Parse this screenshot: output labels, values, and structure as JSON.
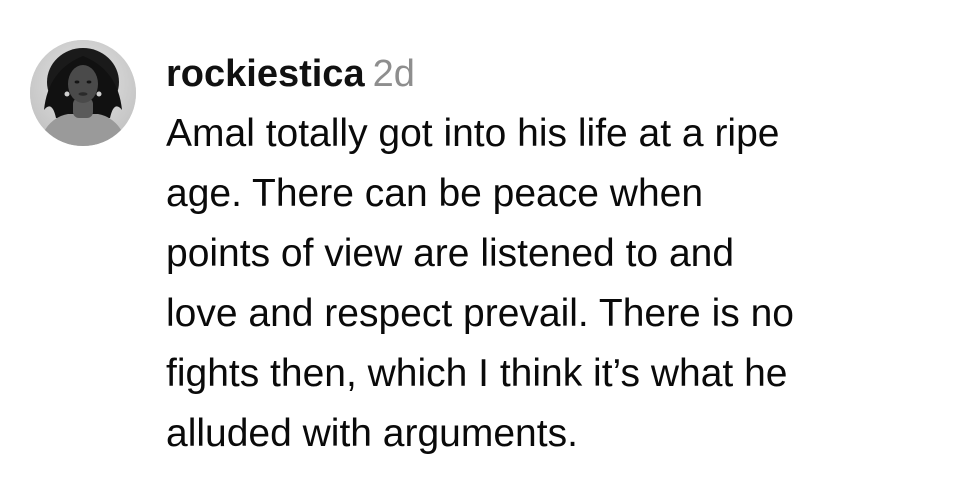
{
  "comment": {
    "username": "rockiestica",
    "timestamp": "2d",
    "text_lines": [
      "Amal totally got into his life at a ripe",
      "age. There can be peace when",
      "points of view are listened to and",
      "love and respect prevail. There is no",
      "fights then, which I think it’s what he",
      "alluded with arguments."
    ]
  },
  "colors": {
    "username": "#111111",
    "timestamp": "#8e8e8e",
    "text": "#0a0a0a",
    "background": "#ffffff"
  },
  "icons": {
    "avatar": "profile-photo"
  }
}
